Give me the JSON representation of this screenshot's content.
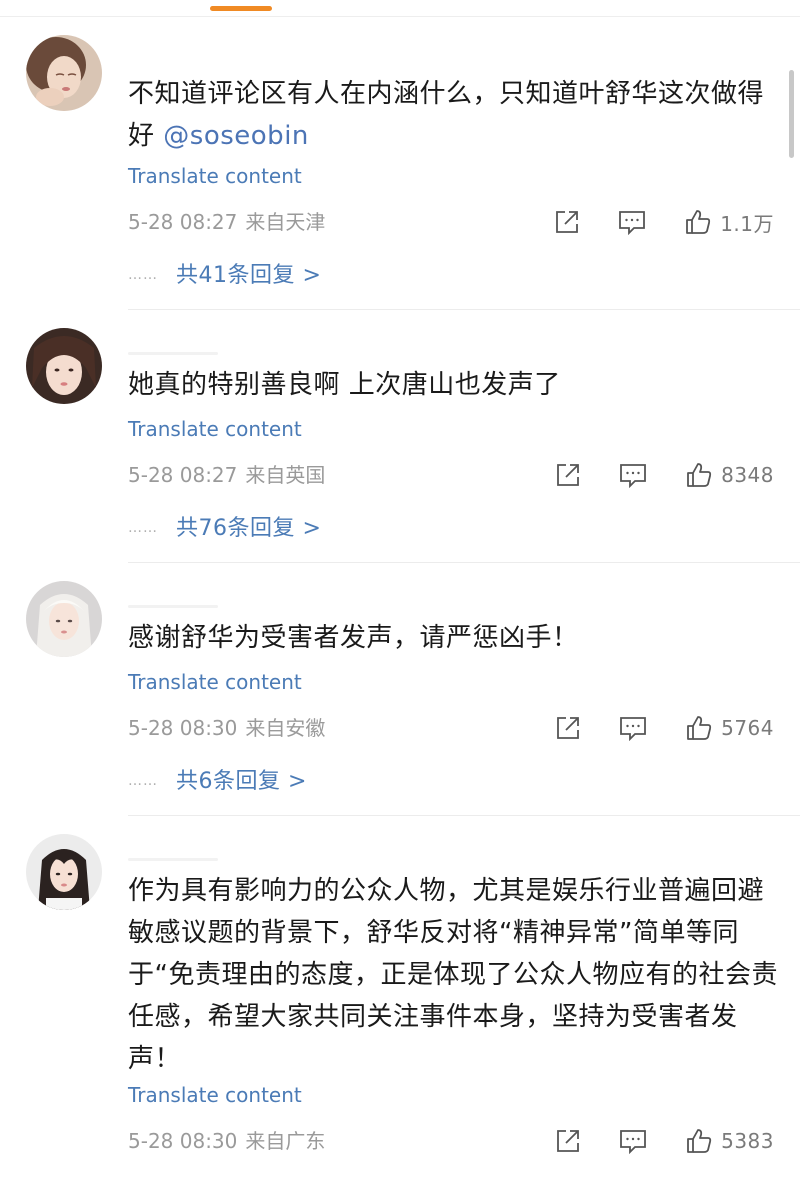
{
  "ui": {
    "translate_label": "Translate content",
    "icons": [
      "share-icon",
      "comment-icon",
      "like-icon"
    ],
    "colors": {
      "tab_indicator": "#f08a24",
      "link": "#4b7bb6",
      "meta": "#9a9a9a"
    }
  },
  "comments": [
    {
      "text": "不知道评论区有人在内涵什么，只知道叶舒华这次做得好",
      "mention": "@soseobin",
      "time": "5-28 08:27",
      "location": "来自天津",
      "likes": "1.1万",
      "replies_dots": "……",
      "replies_label": "共41条回复 >"
    },
    {
      "text": "她真的特别善良啊 上次唐山也发声了",
      "mention": "",
      "time": "5-28 08:27",
      "location": "来自英国",
      "likes": "8348",
      "replies_dots": "……",
      "replies_label": "共76条回复 >"
    },
    {
      "text": "感谢舒华为受害者发声，请严惩凶手！",
      "mention": "",
      "time": "5-28 08:30",
      "location": "来自安徽",
      "likes": "5764",
      "replies_dots": "……",
      "replies_label": "共6条回复 >"
    },
    {
      "text": "作为具有影响力的公众人物，尤其是娱乐行业普遍回避敏感议题的背景下，舒华反对将“精神异常”简单等同于“免责理由的态度，正是体现了公众人物应有的社会责任感，希望大家共同关注事件本身，坚持为受害者发声！",
      "mention": "",
      "time": "5-28 08:30",
      "location": "来自广东",
      "likes": "5383"
    }
  ]
}
